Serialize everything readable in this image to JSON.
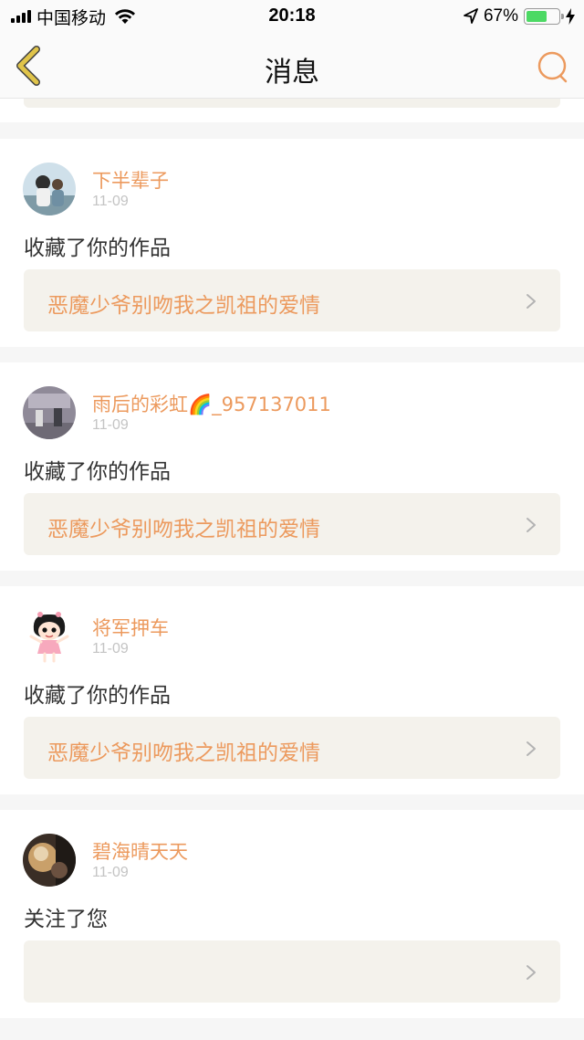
{
  "status_bar": {
    "carrier": "中国移动",
    "time": "20:18",
    "battery": "67%",
    "battery_level": 0.67
  },
  "header": {
    "title": "消息",
    "back_icon": "chevron-left-icon",
    "search_icon": "search-icon"
  },
  "colors": {
    "accent": "#ec9a5e",
    "back_icon": "#e0c44a",
    "work_bg": "#f4f2ec"
  },
  "notifications": [
    {
      "user": "下半辈子",
      "date": "11-09",
      "action": "收藏了你的作品",
      "work_title": "恶魔少爷别吻我之凯祖的爱情"
    },
    {
      "user": "雨后的彩虹🌈_957137011",
      "date": "11-09",
      "action": "收藏了你的作品",
      "work_title": "恶魔少爷别吻我之凯祖的爱情"
    },
    {
      "user": "将军押车",
      "date": "11-09",
      "action": "收藏了你的作品",
      "work_title": "恶魔少爷别吻我之凯祖的爱情"
    },
    {
      "user": "碧海晴天天",
      "date": "11-09",
      "action": "关注了您",
      "work_title": ""
    }
  ]
}
